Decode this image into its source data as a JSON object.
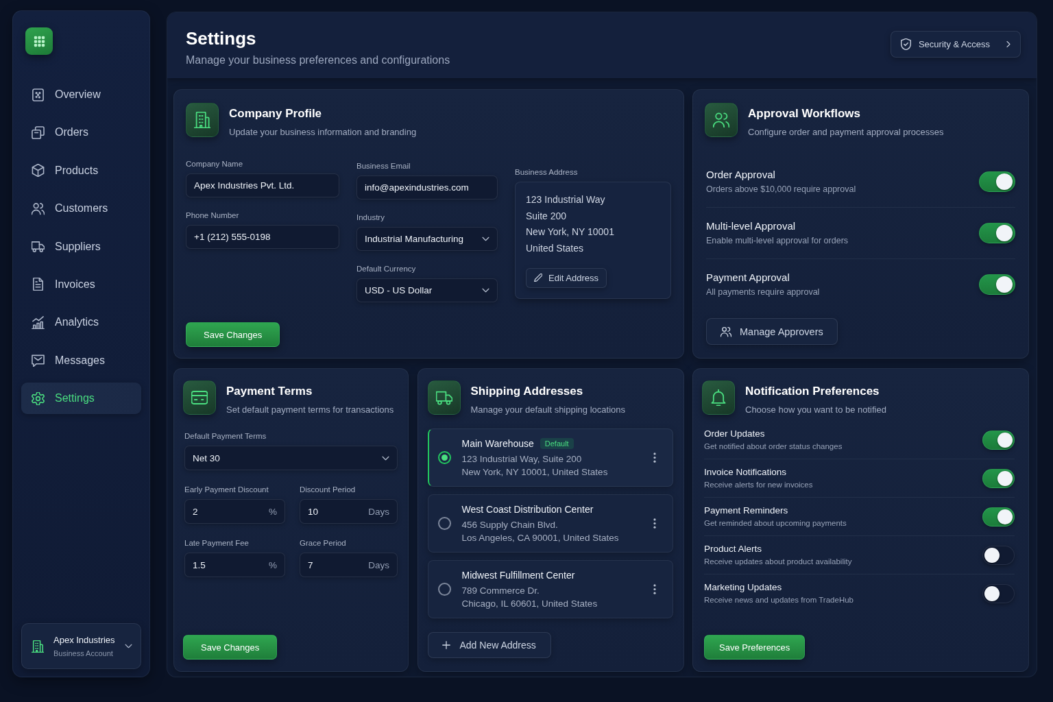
{
  "sidebar": {
    "nav_items": [
      {
        "label": "Overview",
        "selected": false
      },
      {
        "label": "Orders",
        "selected": false
      },
      {
        "label": "Products",
        "selected": false
      },
      {
        "label": "Customers",
        "selected": false
      },
      {
        "label": "Suppliers",
        "selected": false
      },
      {
        "label": "Invoices",
        "selected": false
      },
      {
        "label": "Analytics",
        "selected": false
      },
      {
        "label": "Messages",
        "selected": false
      },
      {
        "label": "Settings",
        "selected": true
      }
    ],
    "account": {
      "name": "Apex Industries",
      "type": "Business Account"
    }
  },
  "header": {
    "title": "Settings",
    "subtitle": "Manage your business preferences and configurations",
    "security_button": "Security & Access"
  },
  "company_profile": {
    "title": "Company Profile",
    "subtitle": "Update your business information and branding",
    "field_columns": [
      [
        {
          "kind": "text",
          "label": "Company Name",
          "value": "Apex Industries Pvt. Ltd."
        },
        {
          "kind": "text",
          "label": "Phone Number",
          "value": "+1 (212) 555-0198"
        }
      ],
      [
        {
          "kind": "text",
          "label": "Business Email",
          "value": "info@apexindustries.com"
        },
        {
          "kind": "select",
          "label": "Industry",
          "value": "Industrial Manufacturing"
        },
        {
          "kind": "select",
          "label": "Default Currency",
          "value": "USD - US Dollar"
        }
      ]
    ],
    "address": {
      "label": "Business Address",
      "lines": [
        "123 Industrial Way",
        "Suite 200",
        "New York, NY 10001",
        "United States"
      ],
      "edit_button": "Edit Address"
    },
    "save_button": "Save Changes"
  },
  "approval_workflows": {
    "title": "Approval Workflows",
    "subtitle": "Configure order and payment approval processes",
    "rules": [
      {
        "title": "Order Approval",
        "description": "Orders above $10,000 require approval",
        "on": true
      },
      {
        "title": "Multi-level Approval",
        "description": "Enable multi-level approval for orders",
        "on": true
      },
      {
        "title": "Payment Approval",
        "description": "All payments require approval",
        "on": true
      }
    ],
    "manage_button": "Manage Approvers"
  },
  "payment_terms": {
    "title": "Payment Terms",
    "subtitle": "Set default payment terms for transactions",
    "fields": [
      {
        "kind": "select",
        "label": "Default Payment Terms",
        "value": "Net 30"
      },
      {
        "kind": "number",
        "label": "Early Payment Discount",
        "value": "2",
        "unit": "%"
      },
      {
        "kind": "number",
        "label": "Discount Period",
        "value": "10",
        "unit": "Days"
      },
      {
        "kind": "number",
        "label": "Late Payment Fee",
        "value": "1.5",
        "unit": "%"
      },
      {
        "kind": "number",
        "label": "Grace Period",
        "value": "7",
        "unit": "Days"
      }
    ],
    "save_button": "Save Changes"
  },
  "shipping_addresses": {
    "title": "Shipping Addresses",
    "subtitle": "Manage your default shipping locations",
    "addresses": [
      {
        "name": "Main Warehouse",
        "badge": "Default",
        "lines": [
          "123 Industrial Way, Suite 200",
          "New York, NY 10001, United States"
        ],
        "selected": true
      },
      {
        "name": "West Coast Distribution Center",
        "lines": [
          "456 Supply Chain Blvd.",
          "Los Angeles, CA 90001, United States"
        ],
        "selected": false
      },
      {
        "name": "Midwest Fulfillment Center",
        "lines": [
          "789 Commerce Dr.",
          "Chicago, IL 60601, United States"
        ],
        "selected": false
      }
    ],
    "add_button": "Add New Address"
  },
  "notification_preferences": {
    "title": "Notification Preferences",
    "subtitle": "Choose how you want to be notified",
    "items": [
      {
        "title": "Order Updates",
        "description": "Get notified about order status changes",
        "on": true
      },
      {
        "title": "Invoice Notifications",
        "description": "Receive alerts for new invoices",
        "on": true
      },
      {
        "title": "Payment Reminders",
        "description": "Get reminded about upcoming payments",
        "on": true
      },
      {
        "title": "Product Alerts",
        "description": "Receive updates about product availability",
        "on": false
      },
      {
        "title": "Marketing Updates",
        "description": "Receive news and updates from TradeHub",
        "on": false
      }
    ],
    "save_button": "Save Preferences"
  }
}
